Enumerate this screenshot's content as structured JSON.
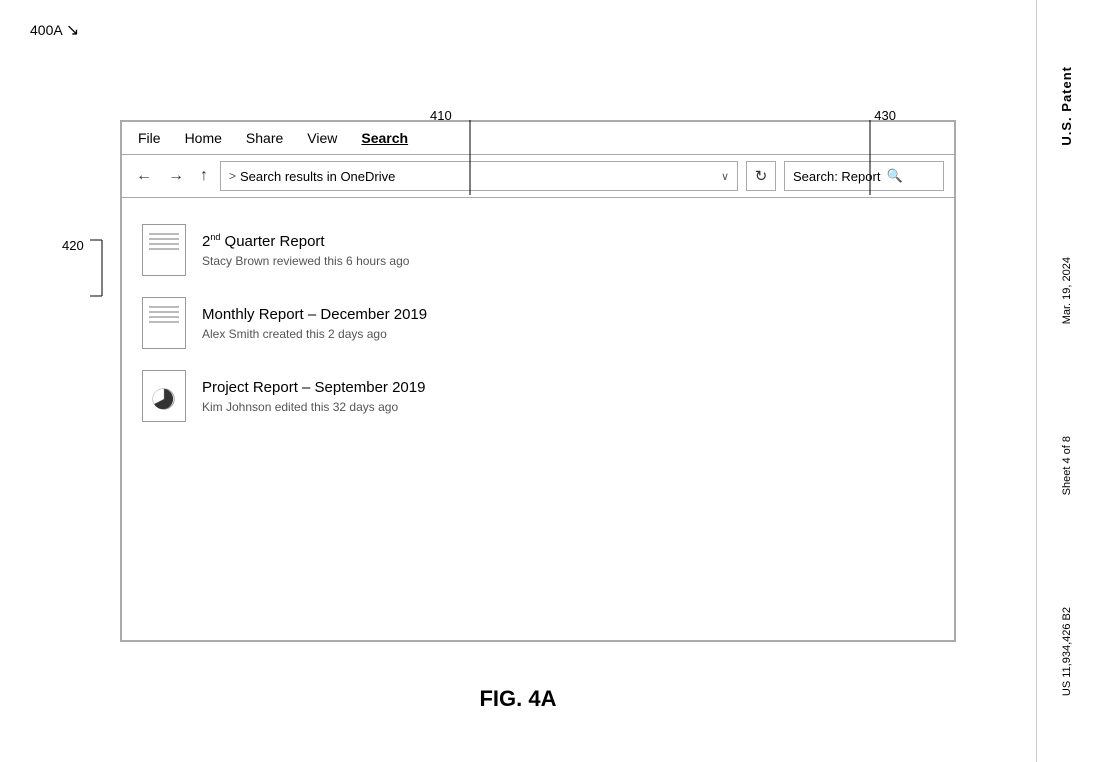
{
  "figure": {
    "label": "400A",
    "caption": "FIG. 4A"
  },
  "patent": {
    "lines": [
      "U.S. Patent",
      "Mar. 19, 2024",
      "Sheet 4 of 8",
      "US 11,934,426 B2"
    ]
  },
  "callouts": {
    "label_400A": "400A",
    "label_410": "410",
    "label_420": "420",
    "label_430": "430"
  },
  "menu": {
    "items": [
      {
        "label": "File",
        "active": false
      },
      {
        "label": "Home",
        "active": false
      },
      {
        "label": "Share",
        "active": false
      },
      {
        "label": "View",
        "active": false
      },
      {
        "label": "Search",
        "active": true
      }
    ]
  },
  "toolbar": {
    "back_label": "←",
    "forward_label": "→",
    "up_label": "↑",
    "address_chevron": ">",
    "address_text": "Search results in OneDrive",
    "dropdown_char": "∨",
    "refresh_char": "↻",
    "search_label": "Search: Report",
    "search_icon": "🔍"
  },
  "files": [
    {
      "id": "file-1",
      "name_prefix": "2",
      "name_sup": "nd",
      "name_suffix": " Quarter Report",
      "meta": "Stacy Brown reviewed this 6 hours ago",
      "icon_type": "lines"
    },
    {
      "id": "file-2",
      "name": "Monthly Report – December 2019",
      "meta": "Alex Smith created this 2 days ago",
      "icon_type": "lines"
    },
    {
      "id": "file-3",
      "name": "Project Report – September 2019",
      "meta": "Kim Johnson edited this 32 days ago",
      "icon_type": "chart"
    }
  ]
}
